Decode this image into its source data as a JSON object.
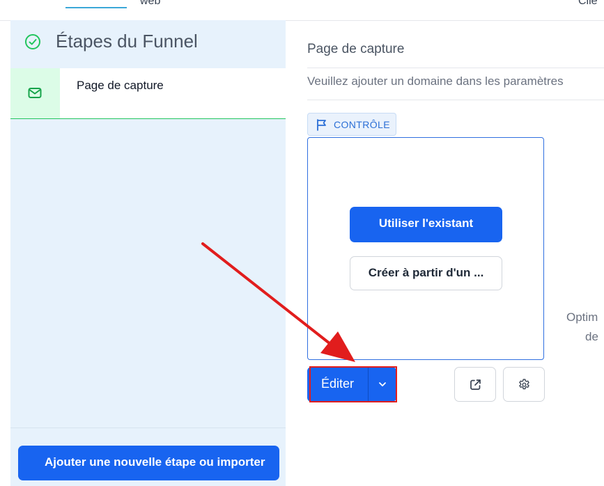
{
  "topbar": {
    "tab_web": "web",
    "tab_right": "Clie"
  },
  "sidebar": {
    "title": "Étapes du Funnel",
    "steps": [
      {
        "label": "Page de capture",
        "icon": "mail-icon"
      }
    ],
    "add_step_label": "Ajouter une nouvelle étape ou importer"
  },
  "main": {
    "title": "Page de capture",
    "domain_notice": "Veuillez ajouter un domaine dans les paramètres",
    "control_badge": "CONTRÔLE",
    "use_existing_label": "Utiliser l'existant",
    "create_from_label": "Créer à partir d'un ...",
    "side_text_line1": "Optim",
    "side_text_line2": "de",
    "edit_label": "Éditer"
  },
  "colors": {
    "primary": "#1864f0",
    "sidebar_bg": "#e7f2fc",
    "success": "#22c55e",
    "annotation": "#e11d1d"
  }
}
